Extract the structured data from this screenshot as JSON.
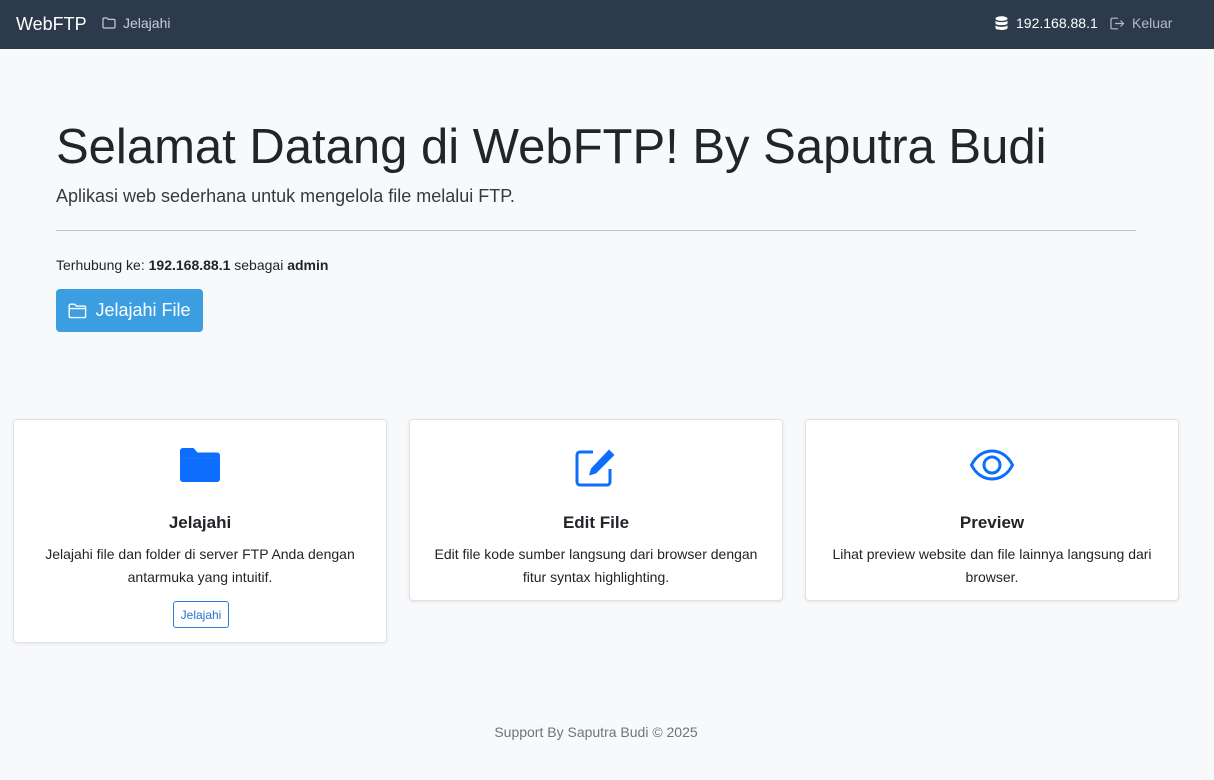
{
  "navbar": {
    "brand": "WebFTP",
    "browse_label": "Jelajahi",
    "host": "192.168.88.1",
    "logout_label": "Keluar"
  },
  "hero": {
    "title": "Selamat Datang di WebFTP! By Saputra Budi",
    "lead": "Aplikasi web sederhana untuk mengelola file melalui FTP.",
    "connected_prefix": "Terhubung ke:",
    "connected_host": "192.168.88.1",
    "connected_as": "sebagai",
    "connected_user": "admin",
    "button_label": "Jelajahi File"
  },
  "cards": [
    {
      "title": "Jelajahi",
      "text": "Jelajahi file dan folder di server FTP Anda dengan antarmuka yang intuitif.",
      "button_label": "Jelajahi",
      "icon": "folder-icon"
    },
    {
      "title": "Edit File",
      "text": "Edit file kode sumber langsung dari browser dengan fitur syntax highlighting.",
      "icon": "edit-icon"
    },
    {
      "title": "Preview",
      "text": "Lihat preview website dan file lainnya langsung dari browser.",
      "icon": "eye-icon"
    }
  ],
  "footer": {
    "text": "Support By Saputra Budi © 2025"
  },
  "colors": {
    "navbar_bg": "#2c3a4c",
    "primary_button": "#3b9ee0",
    "icon_blue": "#0d6efd"
  }
}
